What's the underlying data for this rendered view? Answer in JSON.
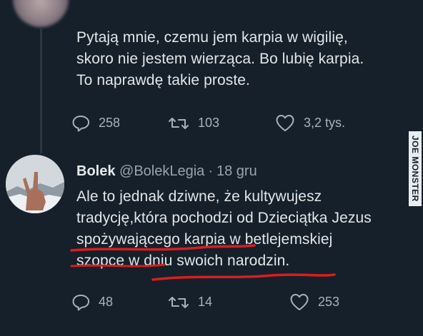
{
  "tweet1": {
    "text_lines": [
      "Pytają mnie, czemu jem karpia w wigilię,",
      "skoro nie jestem wierząca. Bo lubię karpia.",
      "To naprawdę takie proste."
    ],
    "actions": {
      "replies": "258",
      "retweets": "103",
      "likes": "3,2 tys."
    }
  },
  "tweet2": {
    "author_name": "Bolek",
    "handle": "@BolekLegia",
    "separator": "·",
    "date": "18 gru",
    "text_lines": [
      "Ale to jednak dziwne, że kultywujesz",
      "tradycję,która pochodzi od Dzieciątka Jezus",
      "spożywającego karpia w betlejemskiej",
      "szopce w dniu swoich narodzin."
    ],
    "actions": {
      "replies": "48",
      "retweets": "14",
      "likes": "253"
    }
  },
  "watermark": "JOE MONSTER",
  "colors": {
    "background": "#15202b",
    "underline": "#d81e1e",
    "text": "#e3e6e8",
    "muted": "#9aa3ab"
  }
}
